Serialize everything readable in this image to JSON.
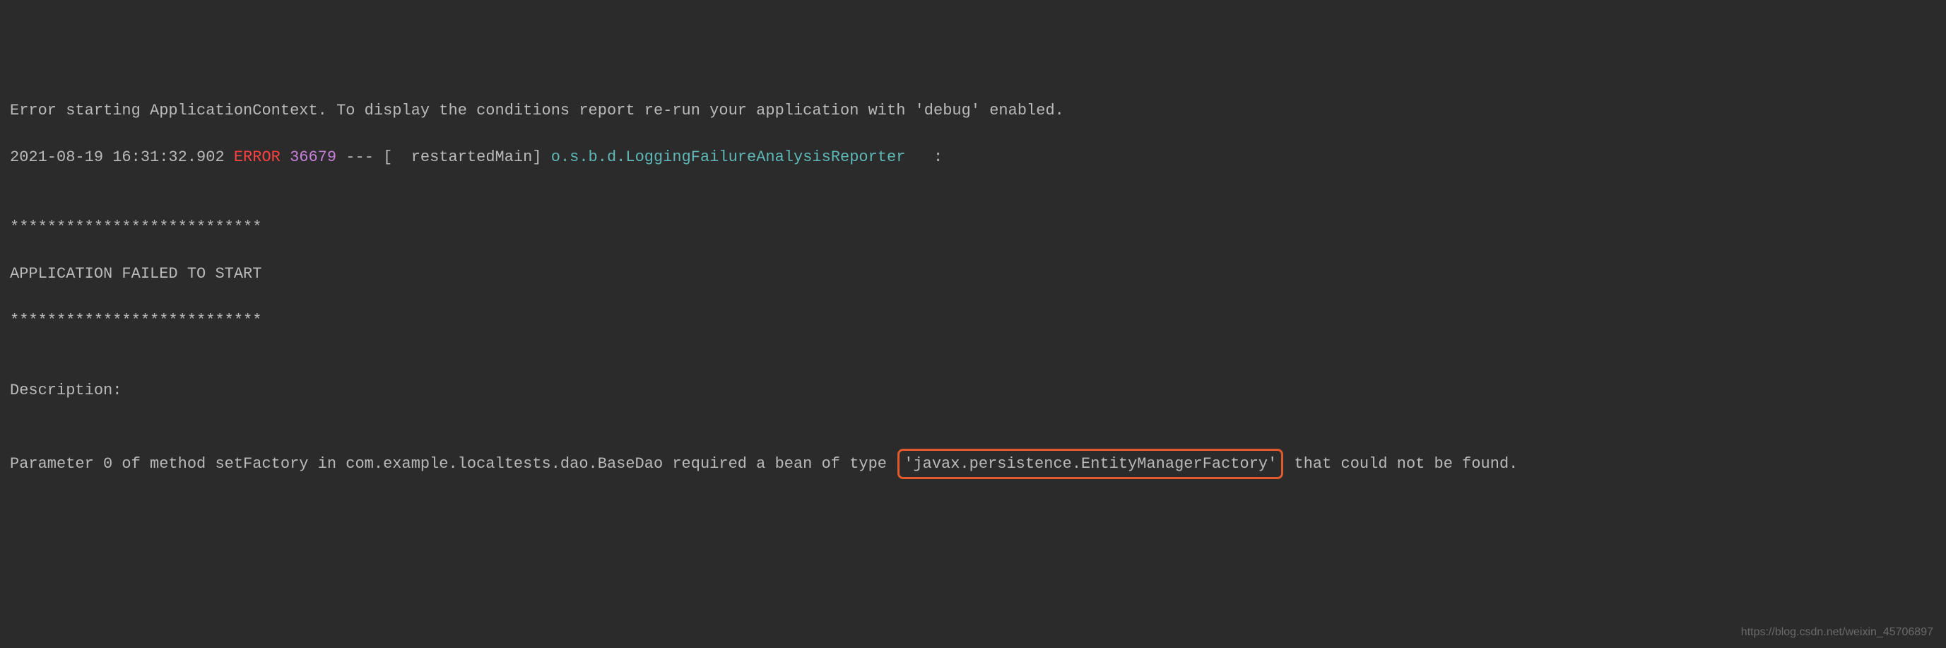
{
  "lines": {
    "line1": "Error starting ApplicationContext. To display the conditions report re-run your application with 'debug' enabled.",
    "line2_timestamp": "2021-08-19 16:31:32.902 ",
    "line2_level": "ERROR",
    "line2_sep1": " ",
    "line2_pid": "36679",
    "line2_sep2": " --- [  restartedMain] ",
    "line2_logger": "o.s.b.d.LoggingFailureAnalysisReporter  ",
    "line2_tail": " :",
    "line3": "",
    "line4": "***************************",
    "line5": "APPLICATION FAILED TO START",
    "line6": "***************************",
    "line7": "",
    "line8": "Description:",
    "line9": "",
    "line10_pre": "Parameter 0 of method setFactory in com.example.localtests.dao.BaseDao required a bean of type ",
    "line10_highlight": "'javax.persistence.EntityManagerFactory'",
    "line10_post": " that could not be found."
  },
  "watermark": "https://blog.csdn.net/weixin_45706897"
}
